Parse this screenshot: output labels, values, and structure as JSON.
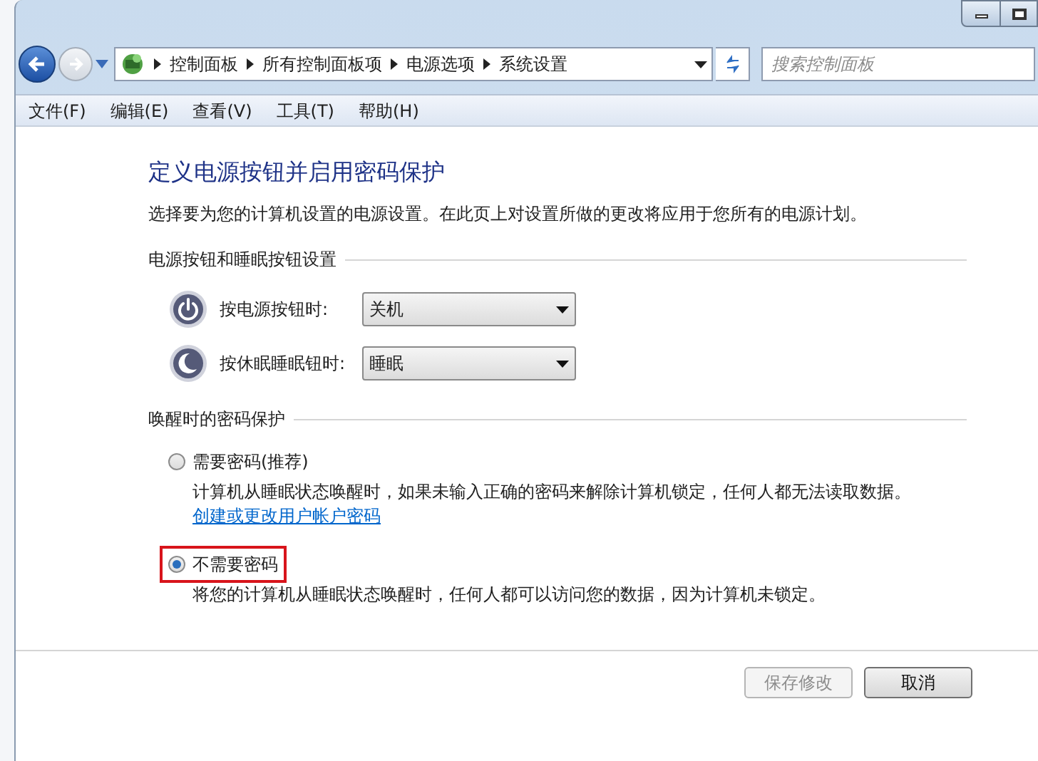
{
  "nav": {
    "breadcrumb": [
      "控制面板",
      "所有控制面板项",
      "电源选项",
      "系统设置"
    ],
    "search": {
      "placeholder": "搜索控制面板"
    }
  },
  "menu": [
    "文件(F)",
    "编辑(E)",
    "查看(V)",
    "工具(T)",
    "帮助(H)"
  ],
  "page": {
    "title": "定义电源按钮并启用密码保护",
    "description": "选择要为您的计算机设置的电源设置。在此页上对设置所做的更改将应用于您所有的电源计划。",
    "button_section": {
      "heading": "电源按钮和睡眠按钮设置",
      "rows": [
        {
          "kind": "power",
          "label": "按电源按钮时:",
          "value": "关机"
        },
        {
          "kind": "sleep",
          "label": "按休眠睡眠钮时:",
          "value": "睡眠"
        }
      ]
    },
    "password_section": {
      "heading": "唤醒时的密码保护",
      "options": [
        {
          "label": "需要密码(推荐)",
          "description": "计算机从睡眠状态唤醒时，如果未输入正确的密码来解除计算机锁定，任何人都无法读取数据。",
          "link": "创建或更改用户帐户密码",
          "selected": false,
          "highlighted": false
        },
        {
          "label": "不需要密码",
          "description": "将您的计算机从睡眠状态唤醒时，任何人都可以访问您的数据，因为计算机未锁定。",
          "selected": true,
          "highlighted": true
        }
      ]
    }
  },
  "buttons": [
    {
      "label": "保存修改",
      "disabled": true
    },
    {
      "label": "取消",
      "disabled": false
    }
  ]
}
